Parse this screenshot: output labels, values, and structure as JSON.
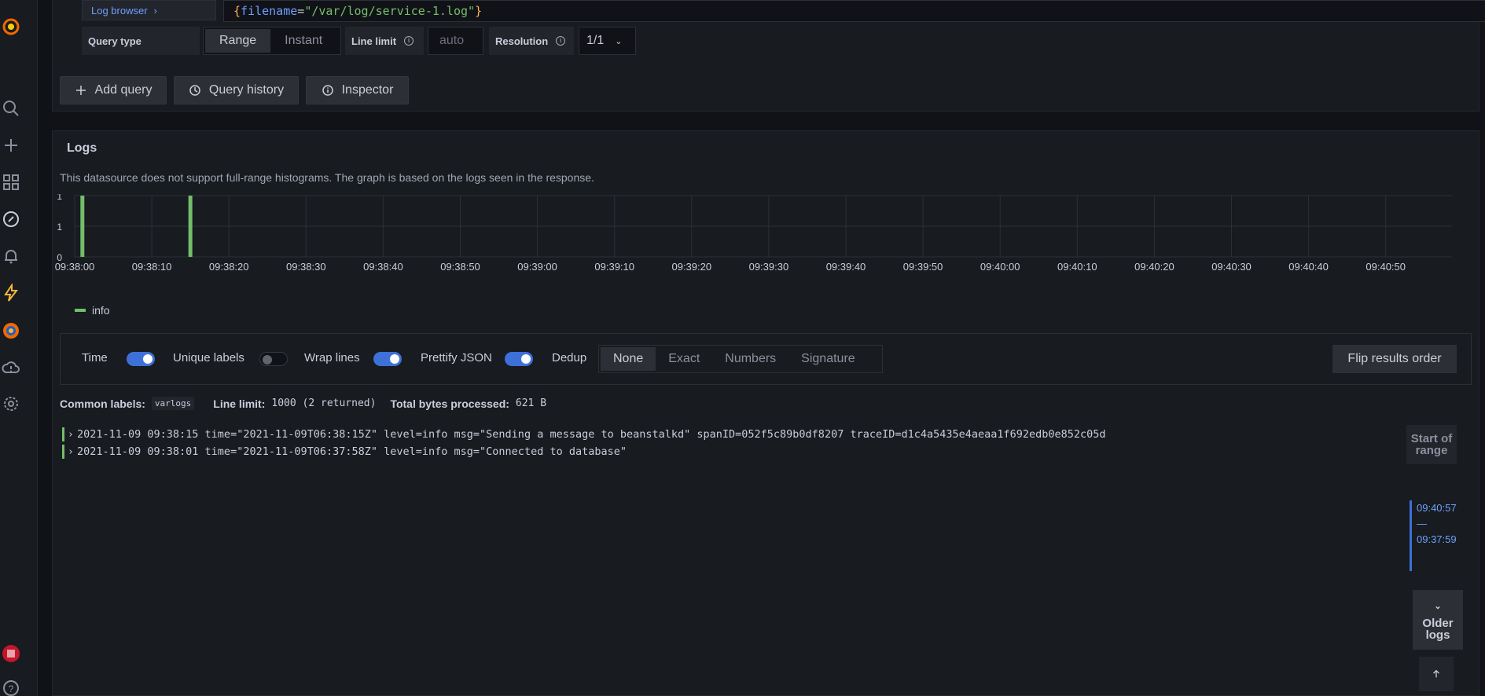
{
  "sidebar": {
    "icons": [
      "grafana-logo-icon",
      "search-icon",
      "plus-icon",
      "dashboards-icon",
      "explore-icon",
      "alerting-icon",
      "lightning-icon",
      "globe-icon",
      "cloud-alert-icon",
      "gear-icon",
      "user-avatar-icon",
      "help-icon"
    ]
  },
  "query": {
    "log_browser_label": "Log browser",
    "brace_open": "{",
    "key": "filename",
    "eq": "=",
    "value": "\"/var/log/service-1.log\"",
    "brace_close": "}",
    "query_type_label": "Query type",
    "query_type_options": [
      "Range",
      "Instant"
    ],
    "query_type_selected": "Range",
    "line_limit_label": "Line limit",
    "line_limit_placeholder": "auto",
    "resolution_label": "Resolution",
    "resolution_value": "1/1"
  },
  "actions": {
    "add_query": "Add query",
    "query_history": "Query history",
    "inspector": "Inspector"
  },
  "logs": {
    "title": "Logs",
    "notice": "This datasource does not support full-range histograms. The graph is based on the logs seen in the response.",
    "legend": "info",
    "options": {
      "time": "Time",
      "unique_labels": "Unique labels",
      "wrap_lines": "Wrap lines",
      "prettify_json": "Prettify JSON",
      "dedup": "Dedup",
      "dedup_options": [
        "None",
        "Exact",
        "Numbers",
        "Signature"
      ],
      "dedup_selected": "None",
      "flip": "Flip results order"
    },
    "meta": {
      "common_labels_label": "Common labels:",
      "common_labels_value": "varlogs",
      "line_limit_label": "Line limit:",
      "line_limit_value": "1000 (2 returned)",
      "bytes_label": "Total bytes processed:",
      "bytes_value": "621 B"
    },
    "rows": [
      "2021-11-09 09:38:15 time=\"2021-11-09T06:38:15Z\" level=info msg=\"Sending a message to beanstalkd\" spanID=052f5c89b0df8207 traceID=d1c4a5435e4aeaa1f692edb0e852c05d",
      "2021-11-09 09:38:01 time=\"2021-11-09T06:37:58Z\" level=info msg=\"Connected to database\""
    ],
    "nav": {
      "start_of_range": "Start of range",
      "range_top": "09:40:57",
      "range_sep": "—",
      "range_bottom": "09:37:59",
      "older_logs": "Older logs"
    }
  },
  "chart_data": {
    "type": "bar",
    "x": [
      "09:38:00",
      "09:38:10",
      "09:38:20",
      "09:38:30",
      "09:38:40",
      "09:38:50",
      "09:39:00",
      "09:39:10",
      "09:39:20",
      "09:39:30",
      "09:39:40",
      "09:39:50",
      "09:40:00",
      "09:40:10",
      "09:40:20",
      "09:40:30",
      "09:40:40",
      "09:40:50"
    ],
    "y_ticks": [
      "0",
      "1",
      "1"
    ],
    "series": [
      {
        "name": "info",
        "points": [
          {
            "t": "09:38:01",
            "v": 1
          },
          {
            "t": "09:38:15",
            "v": 1
          }
        ],
        "color": "#73bf69"
      }
    ],
    "ylim": [
      0,
      1
    ],
    "grid": true,
    "legend_position": "bottom-left"
  }
}
